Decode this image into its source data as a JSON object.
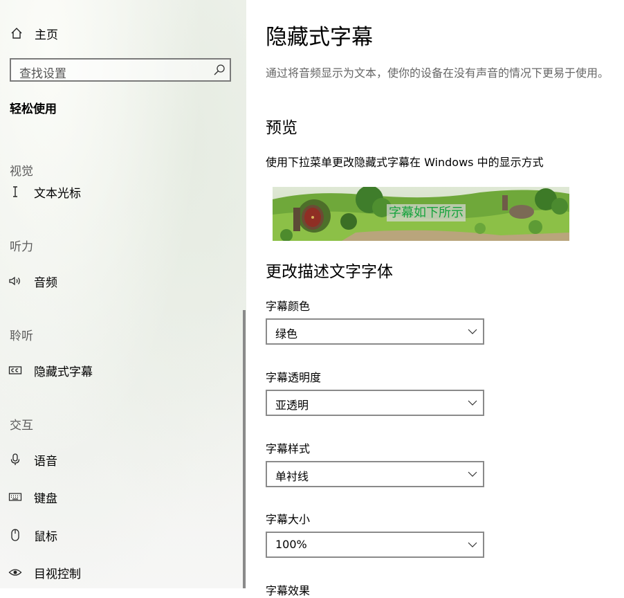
{
  "sidebar": {
    "home_label": "主页",
    "search_placeholder": "查找设置",
    "section_title": "轻松使用",
    "groups": {
      "vision": "视觉",
      "hearing": "听力",
      "listening": "聆听",
      "interaction": "交互"
    },
    "items": [
      {
        "label": "文本光标",
        "icon": "text-cursor-icon"
      },
      {
        "label": "音频",
        "icon": "speaker-icon"
      },
      {
        "label": "隐藏式字幕",
        "icon": "closed-captions-icon"
      },
      {
        "label": "语音",
        "icon": "microphone-icon"
      },
      {
        "label": "键盘",
        "icon": "keyboard-icon"
      },
      {
        "label": "鼠标",
        "icon": "mouse-icon"
      },
      {
        "label": "目视控制",
        "icon": "eye-control-icon"
      }
    ]
  },
  "main": {
    "title": "隐藏式字幕",
    "description": "通过将音频显示为文本，使你的设备在没有声音的情况下更易于使用。",
    "preview_heading": "预览",
    "preview_text": "使用下拉菜单更改隐藏式字幕在 Windows 中的显示方式",
    "caption_sample": "字幕如下所示",
    "font_heading": "更改描述文字字体",
    "fields": [
      {
        "label": "字幕颜色",
        "value": "绿色"
      },
      {
        "label": "字幕透明度",
        "value": "亚透明"
      },
      {
        "label": "字幕样式",
        "value": "单衬线"
      },
      {
        "label": "字幕大小",
        "value": "100%"
      }
    ],
    "partial_next_label": "字幕效果"
  },
  "colors": {
    "caption_text": "#16a33c"
  }
}
